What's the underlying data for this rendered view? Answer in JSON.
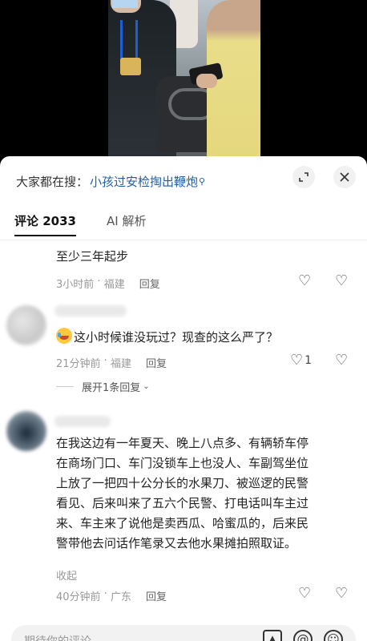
{
  "header": {
    "search_prefix": "大家都在搜：",
    "search_link": "小孩过安检掏出鞭炮",
    "expand_icon": "expand-icon",
    "close_icon": "close-icon"
  },
  "tabs": [
    {
      "label": "评论 2033",
      "active": true
    },
    {
      "label": "AI 解析",
      "active": false
    }
  ],
  "comments": [
    {
      "text": "至少三年起步",
      "time": "3小时前",
      "location": "福建",
      "reply_label": "回复",
      "likes": ""
    },
    {
      "text": "这小时候谁没玩过？现查的这么严了？",
      "time": "21分钟前",
      "location": "福建",
      "reply_label": "回复",
      "likes": "1",
      "expand_label": "展开1条回复"
    },
    {
      "text_lines": [
        "在我这边有一年夏天、晚上八点多、有辆轿车停",
        "在商场门口、车门没锁车上也没人、车副驾坐位",
        "上放了一把四十公分长的水果刀、被巡逻的民警",
        "看见、后来叫来了五六个民警、打电话叫车主过",
        "来、车主来了说他是卖西瓜、哈蜜瓜的，后来民",
        "警带他去问话作笔录又去他水果摊拍照取证。"
      ],
      "collapse_label": "收起",
      "time": "40分钟前",
      "location": "广东",
      "reply_label": "回复",
      "likes": ""
    }
  ],
  "input": {
    "placeholder": "期待你的评论"
  },
  "colors": {
    "link": "#1f5fa8",
    "meta": "#999999"
  }
}
